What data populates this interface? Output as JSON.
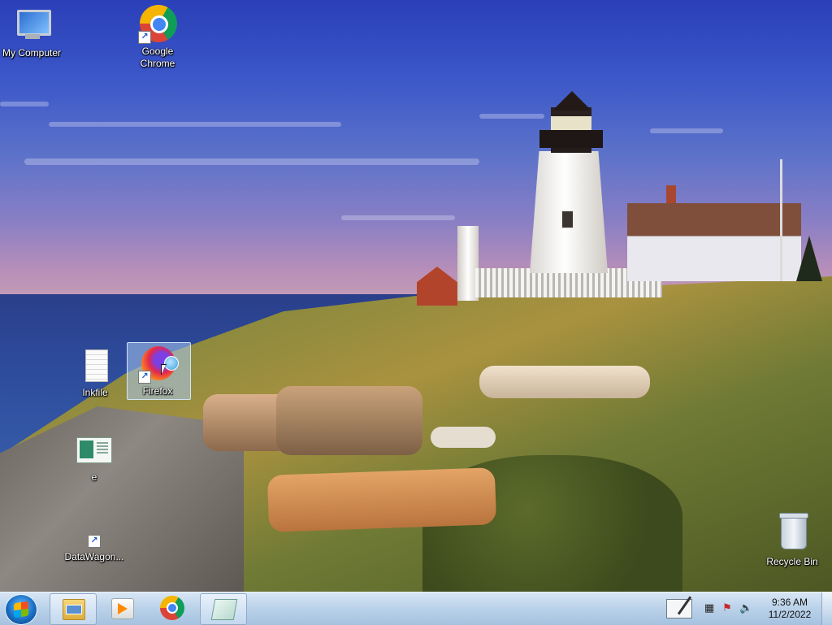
{
  "desktop": {
    "icons": [
      {
        "id": "my-computer",
        "label": "My Computer",
        "icon": "computer-icon"
      },
      {
        "id": "google-chrome",
        "label": "Google\nChrome",
        "icon": "chrome-icon",
        "shortcut": true
      },
      {
        "id": "inkfile",
        "label": "Inkfile",
        "icon": "document-icon"
      },
      {
        "id": "firefox",
        "label": "Firefox",
        "icon": "firefox-icon",
        "shortcut": true,
        "selected": true
      },
      {
        "id": "e",
        "label": "e",
        "icon": "presentation-file-icon"
      },
      {
        "id": "datawagon",
        "label": "DataWagon...",
        "icon": "shortcut-icon",
        "shortcut": true
      },
      {
        "id": "recycle-bin",
        "label": "Recycle Bin",
        "icon": "recycle-bin-icon"
      }
    ]
  },
  "taskbar": {
    "start": {
      "icon": "windows-start-icon"
    },
    "pinned": [
      {
        "id": "explorer",
        "icon": "folder-icon",
        "active": true
      },
      {
        "id": "media-player",
        "icon": "media-player-icon"
      },
      {
        "id": "chrome",
        "icon": "chrome-icon"
      },
      {
        "id": "notepad",
        "icon": "notepad-icon",
        "active": true
      }
    ],
    "tray": {
      "icons": [
        "pen-input-icon",
        "network-icon",
        "action-center-flag-icon",
        "volume-icon"
      ]
    },
    "clock": {
      "time": "9:36 AM",
      "date": "11/2/2022"
    }
  },
  "colors": {
    "taskbar_top": "#d7e6f5",
    "taskbar_bottom": "#a6c2e0",
    "selection": "#aac8f0"
  }
}
